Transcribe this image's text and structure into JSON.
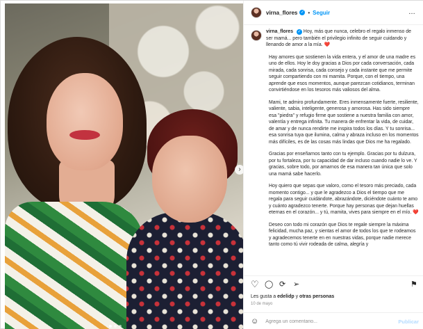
{
  "post": {
    "username": "virna_flores",
    "verified_badge": "✓",
    "separator": "•",
    "follow_label": "Seguir",
    "more_icon": "…"
  },
  "caption": {
    "username": "virna_flores",
    "intro": "Hoy, más que nunca, celebro el regalo inmenso de ser mamá... pero también el privilegio infinito de seguir cuidando y llenando de amor a la mía.",
    "heart": "❤️",
    "paragraphs": [
      "Hay amores que sostienen la vida entera, y el amor de una madre es uno de ellos. Hoy le doy gracias a Dios por cada conversación, cada mirada, cada sonrisa, cada consejo y cada instante que me permite seguir compartiendo con mi mamita. Porque, con el tiempo, una aprende que esos momentos, aunque parezcan cotidianos, terminan convirtiéndose en los tesoros más valiosos del alma.",
      "Mami, te admiro profundamente. Eres inmensamente fuerte, resiliente, valiente, sabia, inteligente, generosa y amorosa. Has sido siempre esa \"piedra\" y refugio firme que sostiene a nuestra familia con amor, valentía y entrega infinita. Tu manera de enfrentar la vida, de cuidar, de amar y de nunca rendirte me inspira todos los días. Y tu sonrisa... esa sonrisa tuya que ilumina, calma y abraza incluso en los momentos más difíciles, es de las cosas más lindas que Dios me ha regalado.",
      "Gracias por enseñarnos tanto con tu ejemplo. Gracias por tu dulzura, por tu fortaleza, por tu capacidad de dar incluso cuando nadie lo ve. Y gracias, sobre todo, por amarnos de esa manera tan única que solo una mamá sabe hacerlo.",
      "Hoy quiero que sepas que valoro, como el tesoro más preciado, cada momento contigo... y que le agradezco a Dios el tiempo que me regala para seguir cuidándote, abrazándote, diciéndote cuánto te amo y cuánto agradezco tenerte. Porque hay personas que dejan huellas eternas en el corazón... y tú, mamita, vives para siempre en el mío.",
      "Deseo con todo mi corazón que Dios te regale siempre la máxima felicidad, mucha paz, y sientas el amor de todos los que te rodeamos y agradecemos tenerte en en nuestras vidas, porque nadie merece tanto como tú vivir rodeada de calma, alegría y"
    ]
  },
  "actions": {
    "like_icon": "♡",
    "comment_icon": "◯",
    "share_icon": "➢",
    "repost_icon": "⟳",
    "save_icon": "⚑"
  },
  "likes": {
    "prefix": "Les gusta a ",
    "user": "edelidp",
    "suffix": " y ",
    "others": "otras personas"
  },
  "date": "10 de mayo",
  "comment": {
    "emoji_icon": "☺",
    "placeholder": "Agrega un comentario...",
    "publish_label": "Publicar"
  },
  "carousel": {
    "next_icon": "›"
  },
  "colors": {
    "accent": "#0095f6",
    "heart": "#ed4956",
    "publish_disabled": "#b3dbff"
  }
}
